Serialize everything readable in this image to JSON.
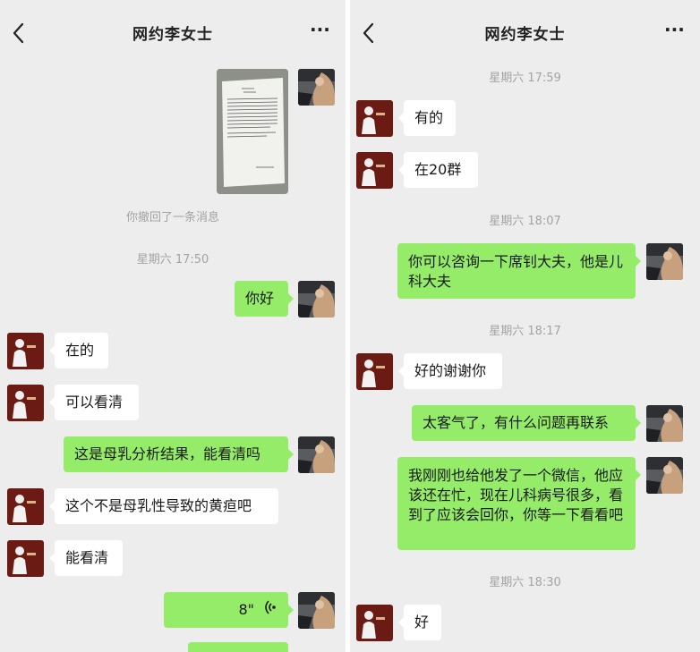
{
  "left": {
    "header": {
      "back_icon": "chevron-left-icon",
      "title": "网约李女士",
      "more_icon": "more-dots-icon",
      "more_glyph": "···"
    },
    "messages": {
      "recall_notice": "你撤回了一条消息",
      "time1": "星期六 17:50",
      "m_hello": "你好",
      "m_zaide": "在的",
      "m_keyikanqing": "可以看清",
      "m_result": "这是母乳分析结果，能看清吗",
      "m_huangdan": "这个不是母乳性导致的黄疸吧",
      "m_nengkanqing": "能看清",
      "voice_duration": "8\"",
      "voice_icon": "voice-wave-icon"
    }
  },
  "right": {
    "header": {
      "back_icon": "chevron-left-icon",
      "title": "网约李女士",
      "more_icon": "more-dots-icon",
      "more_glyph": "···"
    },
    "messages": {
      "time1": "星期六 17:59",
      "m_youde": "有的",
      "m_qun": "在20群",
      "time2": "星期六 18:07",
      "m_xidoctor": "你可以咨询一下席钊大夫，他是儿科大夫",
      "time3": "星期六 18:17",
      "m_thanks": "好的谢谢你",
      "m_keqi": "太客气了，有什么问题再联系",
      "m_wechat": "我刚刚也给他发了一个微信，他应该还在忙，现在儿科病号很多，看到了应该会回你，你等一下看看吧",
      "time4": "星期六 18:30",
      "m_hao": "好"
    }
  },
  "colors": {
    "bg": "#ededed",
    "out_bubble": "#95ec69",
    "in_bubble": "#ffffff",
    "time_text": "#a3a3a3"
  }
}
